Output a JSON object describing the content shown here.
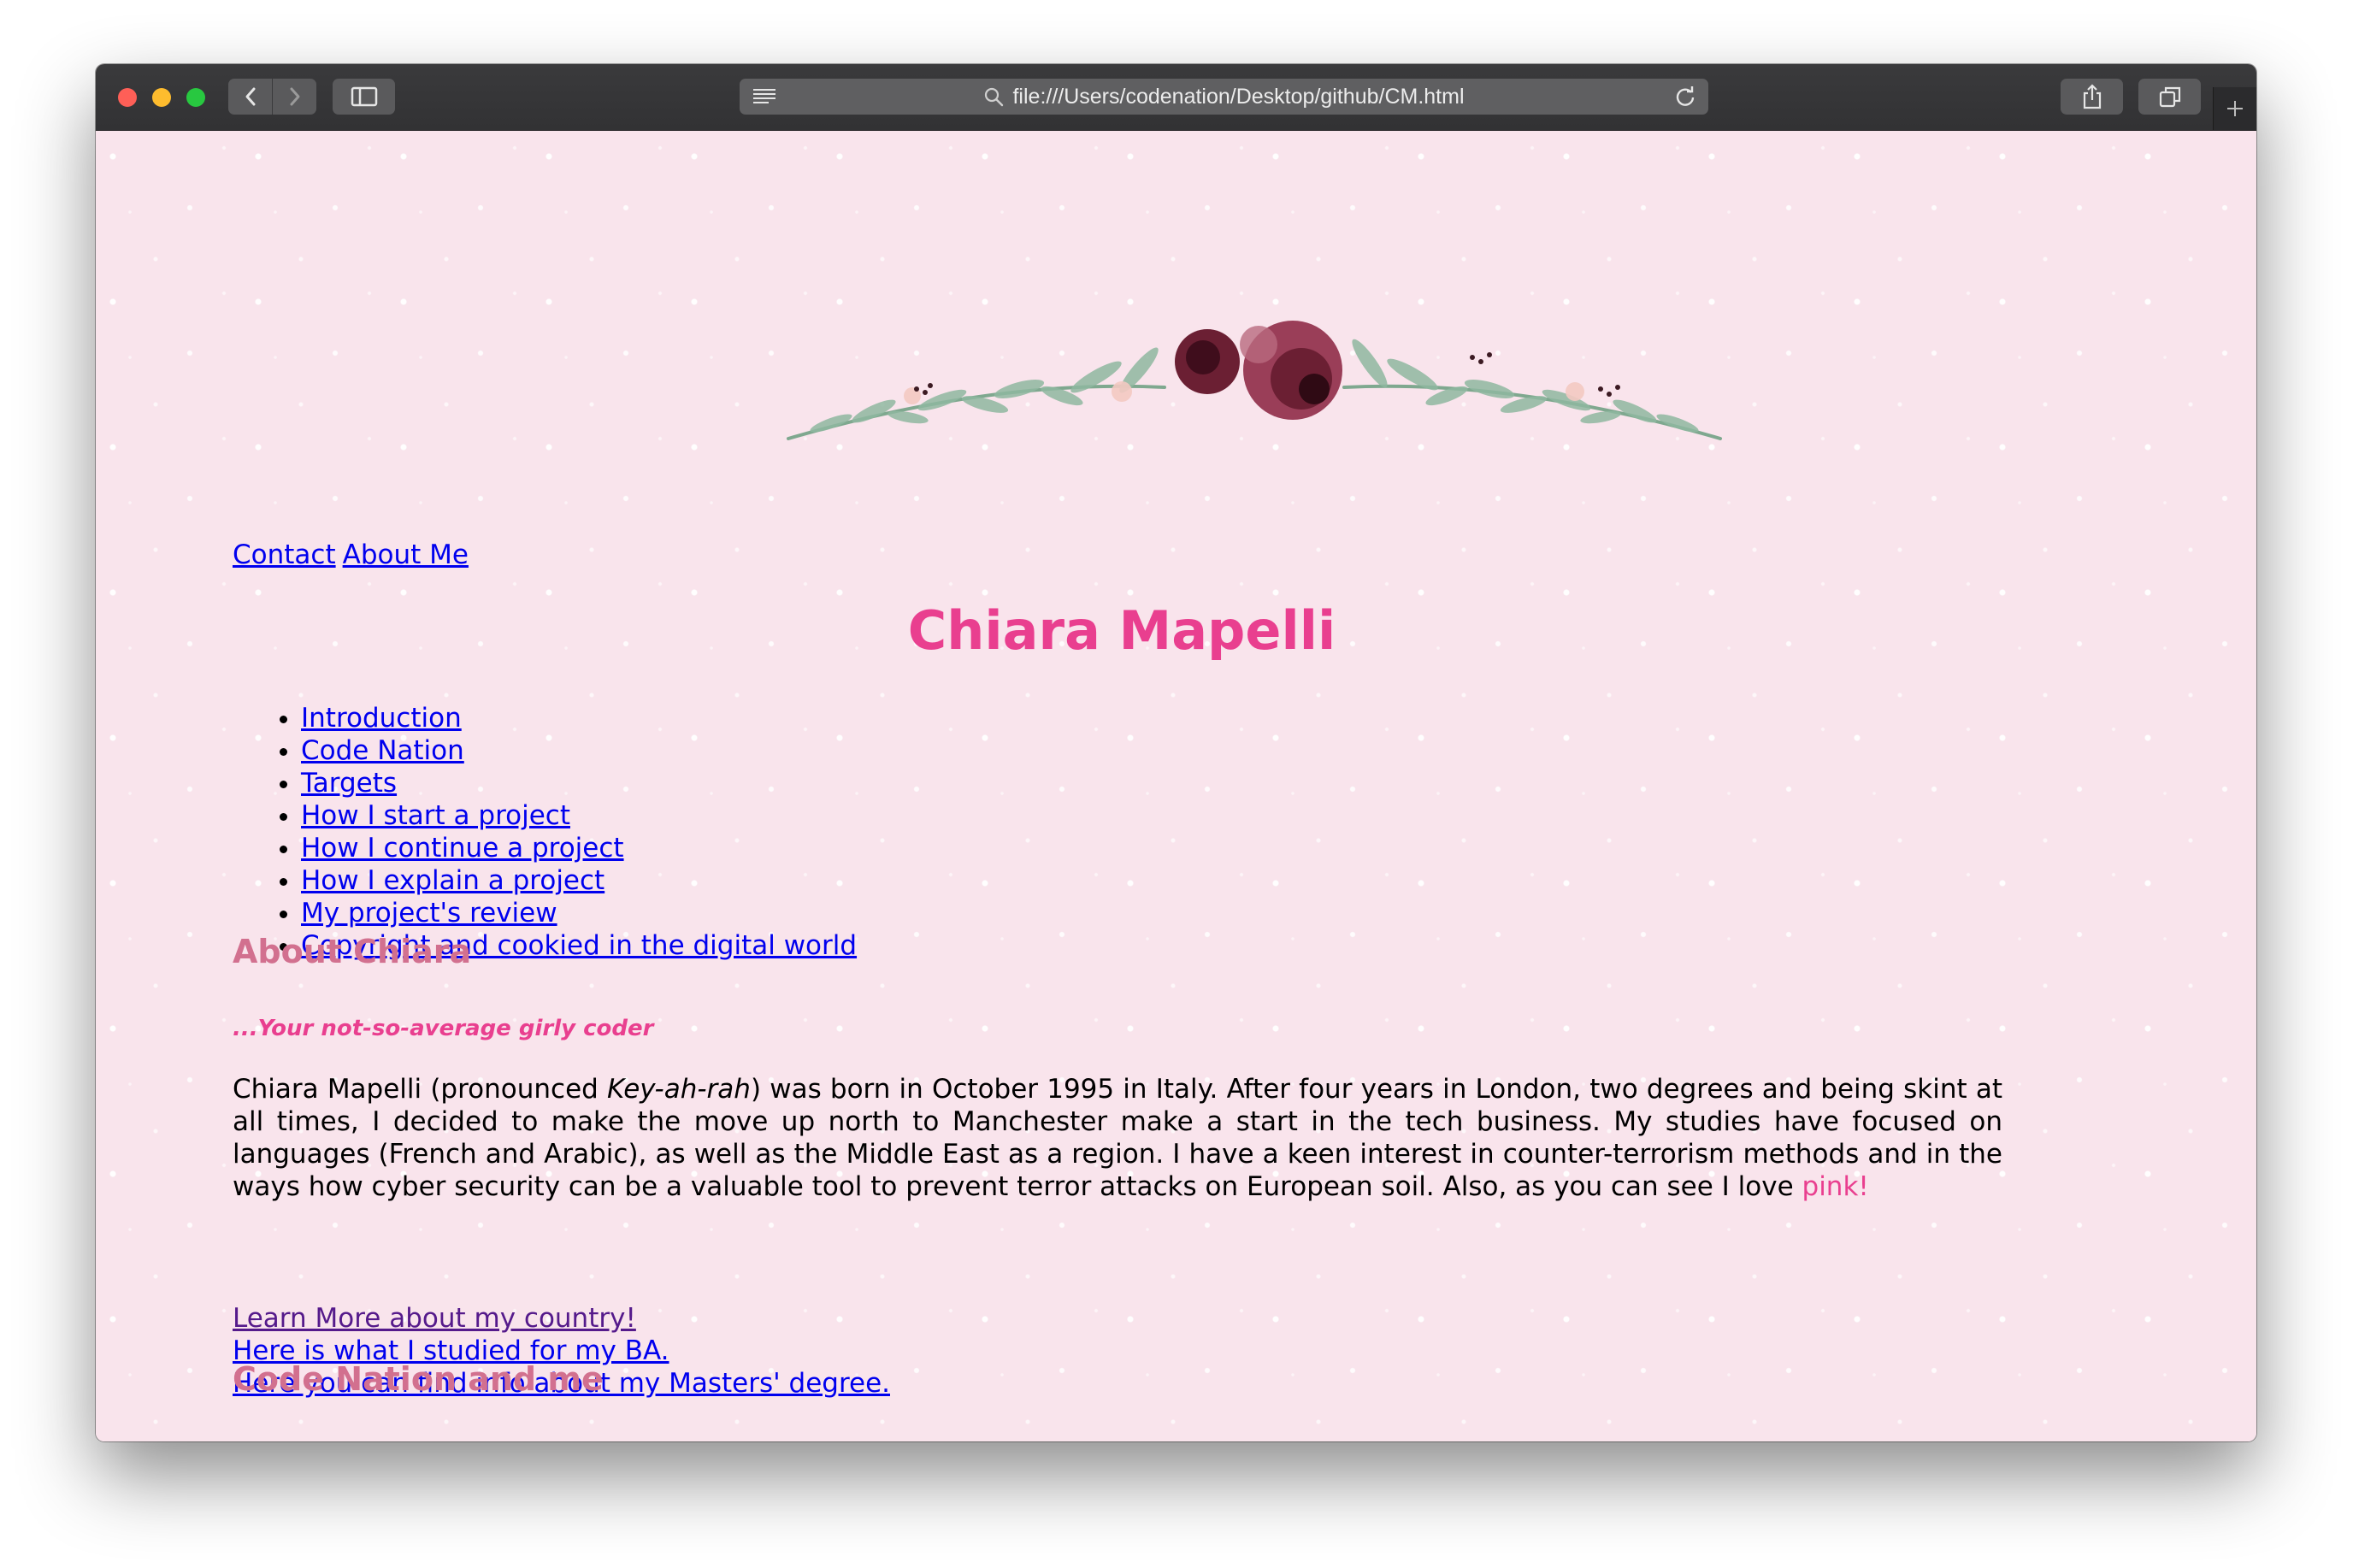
{
  "browser": {
    "url": "file:///Users/codenation/Desktop/github/CM.html"
  },
  "topnav": {
    "contact": "Contact",
    "about": "About Me"
  },
  "title": "Chiara Mapelli",
  "toc": [
    "Introduction",
    "Code Nation",
    "Targets",
    "How I start a project",
    "How I continue a project",
    "How I explain a project",
    "My project's review",
    "Copyright and cookied in the digital world"
  ],
  "about": {
    "heading": "About Chiara",
    "tagline": "...Your not-so-average girly coder",
    "bio_start": "Chiara Mapelli (pronounced ",
    "bio_pron": "Key-ah-rah",
    "bio_rest": ") was born in October 1995 in Italy. After four years in London, two degrees and being skint at all times, I decided to make the move up north to Manchester make a start in the tech business. My studies have focused on languages (French and Arabic), as well as the Middle East as a region. I have a keen interest in counter-terrorism methods and in the ways how cyber security can be a valuable tool to prevent terror attacks on European soil. Also, as you can see I love ",
    "bio_pink": "pink!",
    "links": [
      "Learn More about my country!",
      "Here is what I studied for my BA.",
      "Here you can find info about my Masters' degree."
    ]
  },
  "code_nation": {
    "heading": "Code Nation and me"
  },
  "colors": {
    "accent": "#e93f8f",
    "heading": "#d2708f",
    "background": "#f9e4ec",
    "link": "#0000ee"
  }
}
